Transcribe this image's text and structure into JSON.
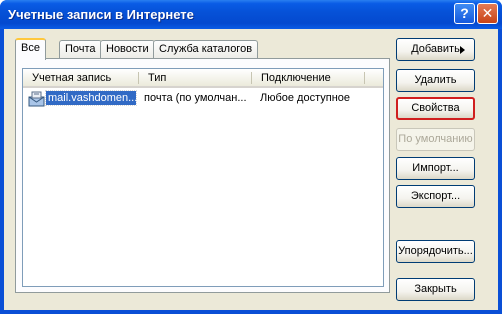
{
  "window": {
    "title": "Учетные записи в Интернете",
    "help_glyph": "?",
    "close_glyph": "✕"
  },
  "tabs": [
    {
      "label": "Все",
      "active": true
    },
    {
      "label": "Почта",
      "active": false
    },
    {
      "label": "Новости",
      "active": false
    },
    {
      "label": "Служба каталогов",
      "active": false
    }
  ],
  "list": {
    "columns": [
      "Учетная запись",
      "Тип",
      "Подключение"
    ],
    "rows": [
      {
        "account": "mail.vashdomen....",
        "type": "почта (по умолчан...",
        "connection": "Любое доступное",
        "selected": true,
        "icon": "mail-account-icon"
      }
    ]
  },
  "buttons": {
    "add": "Добавить",
    "remove": "Удалить",
    "properties": "Свойства",
    "default": "По умолчанию",
    "import": "Импорт...",
    "export": "Экспорт...",
    "order": "Упорядочить...",
    "close": "Закрыть"
  },
  "colors": {
    "titlebar": "#0a5ce6",
    "face": "#ece9d8",
    "selection": "#316ac5",
    "focus_outline": "#d01f1f"
  }
}
